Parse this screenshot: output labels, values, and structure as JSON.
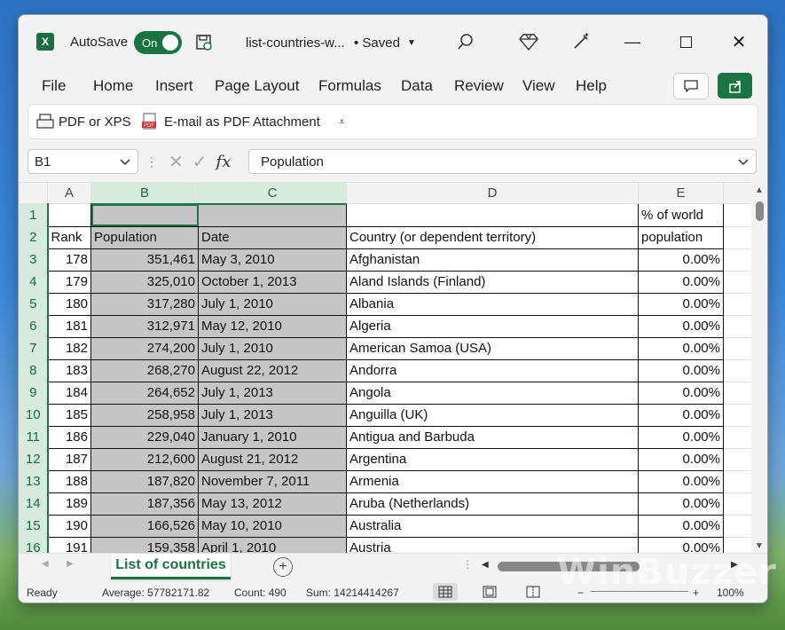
{
  "title_bar": {
    "app_icon": "excel-icon",
    "autosave_label": "AutoSave",
    "autosave_state": "On",
    "document_name": "list-countries-w...",
    "saved_status": "• Saved"
  },
  "menu": [
    "File",
    "Home",
    "Insert",
    "Page Layout",
    "Formulas",
    "Data",
    "Review",
    "View",
    "Help"
  ],
  "toolbar": {
    "pdf_label": "PDF or XPS",
    "email_label": "E-mail as PDF Attachment"
  },
  "formula_bar": {
    "name_box": "B1",
    "fx": "fx",
    "content": "Population"
  },
  "columns": [
    "A",
    "B",
    "C",
    "D",
    "E"
  ],
  "header_rows": [
    {
      "num": "1",
      "a": "",
      "b": "",
      "c": "",
      "d": "",
      "e": "% of world"
    },
    {
      "num": "2",
      "a": "Rank",
      "b": "Population",
      "c": "Date",
      "d": "Country (or dependent territory)",
      "e": "population"
    }
  ],
  "rows": [
    {
      "num": "3",
      "rank": "178",
      "population": "351,461",
      "date": "May 3, 2010",
      "country": "Afghanistan",
      "pct": "0.00%"
    },
    {
      "num": "4",
      "rank": "179",
      "population": "325,010",
      "date": "October 1, 2013",
      "country": "Aland Islands (Finland)",
      "pct": "0.00%"
    },
    {
      "num": "5",
      "rank": "180",
      "population": "317,280",
      "date": "July 1, 2010",
      "country": "Albania",
      "pct": "0.00%"
    },
    {
      "num": "6",
      "rank": "181",
      "population": "312,971",
      "date": "May 12, 2010",
      "country": "Algeria",
      "pct": "0.00%"
    },
    {
      "num": "7",
      "rank": "182",
      "population": "274,200",
      "date": "July 1, 2010",
      "country": "American Samoa (USA)",
      "pct": "0.00%"
    },
    {
      "num": "8",
      "rank": "183",
      "population": "268,270",
      "date": "August 22, 2012",
      "country": "Andorra",
      "pct": "0.00%"
    },
    {
      "num": "9",
      "rank": "184",
      "population": "264,652",
      "date": "July 1, 2013",
      "country": "Angola",
      "pct": "0.00%"
    },
    {
      "num": "10",
      "rank": "185",
      "population": "258,958",
      "date": "July 1, 2013",
      "country": "Anguilla (UK)",
      "pct": "0.00%"
    },
    {
      "num": "11",
      "rank": "186",
      "population": "229,040",
      "date": "January 1, 2010",
      "country": "Antigua and Barbuda",
      "pct": "0.00%"
    },
    {
      "num": "12",
      "rank": "187",
      "population": "212,600",
      "date": "August 21, 2012",
      "country": "Argentina",
      "pct": "0.00%"
    },
    {
      "num": "13",
      "rank": "188",
      "population": "187,820",
      "date": "November 7, 2011",
      "country": "Armenia",
      "pct": "0.00%"
    },
    {
      "num": "14",
      "rank": "189",
      "population": "187,356",
      "date": "May 13, 2012",
      "country": "Aruba (Netherlands)",
      "pct": "0.00%"
    },
    {
      "num": "15",
      "rank": "190",
      "population": "166,526",
      "date": "May 10, 2010",
      "country": "Australia",
      "pct": "0.00%"
    },
    {
      "num": "16",
      "rank": "191",
      "population": "159,358",
      "date": "April 1, 2010",
      "country": "Austria",
      "pct": "0.00%"
    }
  ],
  "sheet_tab": "List of countries",
  "status": {
    "ready": "Ready",
    "average": "Average: 57782171.82",
    "count": "Count: 490",
    "sum": "Sum: 14214414267",
    "zoom": "100%"
  },
  "watermark": "WinBuzzer",
  "colors": {
    "accent": "#1a7343",
    "selection": "#c6c6c6"
  }
}
